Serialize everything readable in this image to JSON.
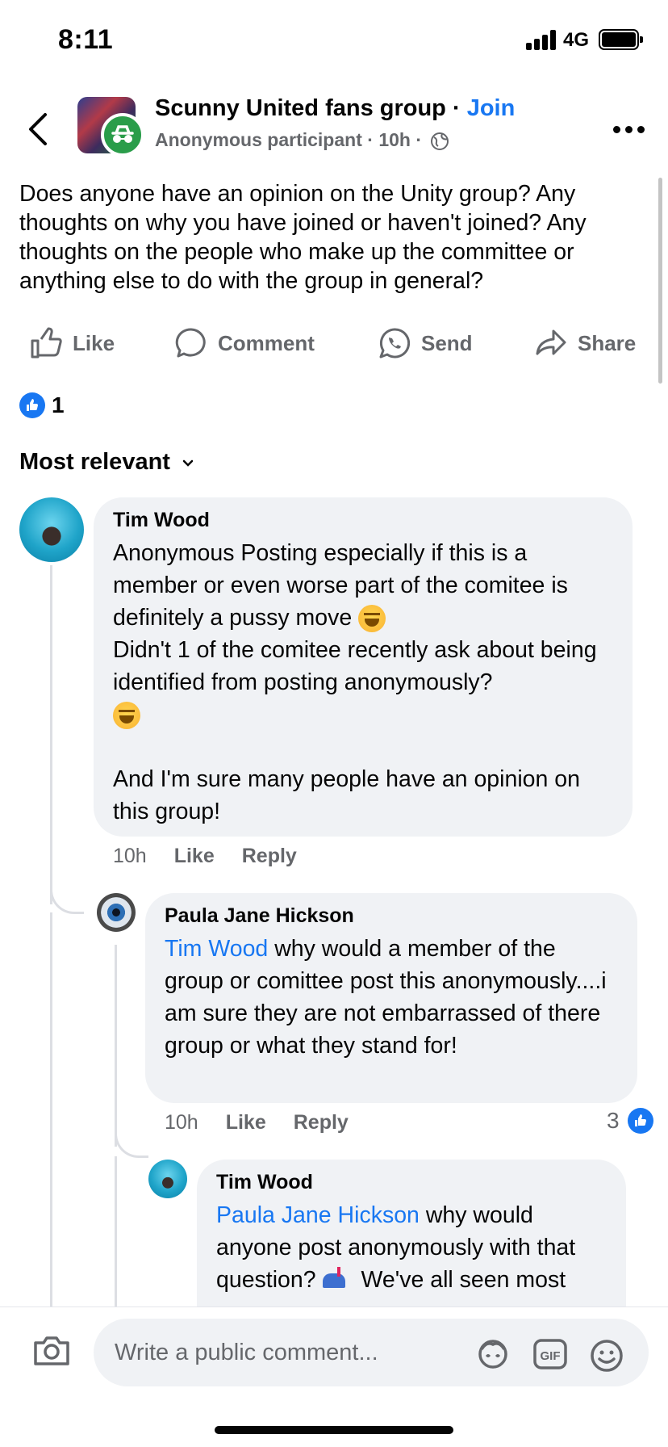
{
  "status_bar": {
    "time": "8:11",
    "network": "4G"
  },
  "header": {
    "group_name": "Scunny United fans group",
    "separator": " · ",
    "join_label": "Join",
    "author": "Anonymous participant",
    "time": "10h"
  },
  "post": {
    "text": "Does anyone have an opinion on the Unity group? Any thoughts on why you have joined or haven't joined? Any thoughts on the people who make up the committee or anything else to do with the group in general?"
  },
  "actions": {
    "like": "Like",
    "comment": "Comment",
    "send": "Send",
    "share": "Share"
  },
  "reactions": {
    "count": "1"
  },
  "sort": {
    "label": "Most relevant"
  },
  "comments": [
    {
      "author": "Tim Wood",
      "line1": "Anonymous Posting especially if this is a member or even worse part of the comitee is definitely a pussy move",
      "line2": "Didn't 1 of the comitee recently ask about being identified from posting anonymously?",
      "line3": "And I'm sure many people have an opinion on this group!",
      "time": "10h",
      "like_label": "Like",
      "reply_label": "Reply"
    },
    {
      "author": "Paula Jane Hickson",
      "mention": "Tim Wood",
      "text": " why would a member of the group or comittee post this anonymously....i am sure they are not embarrassed of there group or what they stand for!",
      "time": "10h",
      "like_label": "Like",
      "reply_label": "Reply",
      "likes": "3"
    },
    {
      "author": "Tim Wood",
      "mention": "Paula Jane Hickson",
      "text_part1": " why would anyone post anonymously with that question?",
      "text_part2": " We've all seen most"
    }
  ],
  "composer": {
    "placeholder": "Write a public comment..."
  },
  "colors": {
    "accent": "#1877f2",
    "secondary_text": "#65676b",
    "bubble": "#f0f2f5"
  },
  "icons": [
    "back-icon",
    "more-icon",
    "like-icon",
    "comment-icon",
    "whatsapp-icon",
    "share-icon",
    "chevron-down-icon",
    "camera-icon",
    "avatar-sticker-icon",
    "gif-icon",
    "emoji-icon"
  ]
}
